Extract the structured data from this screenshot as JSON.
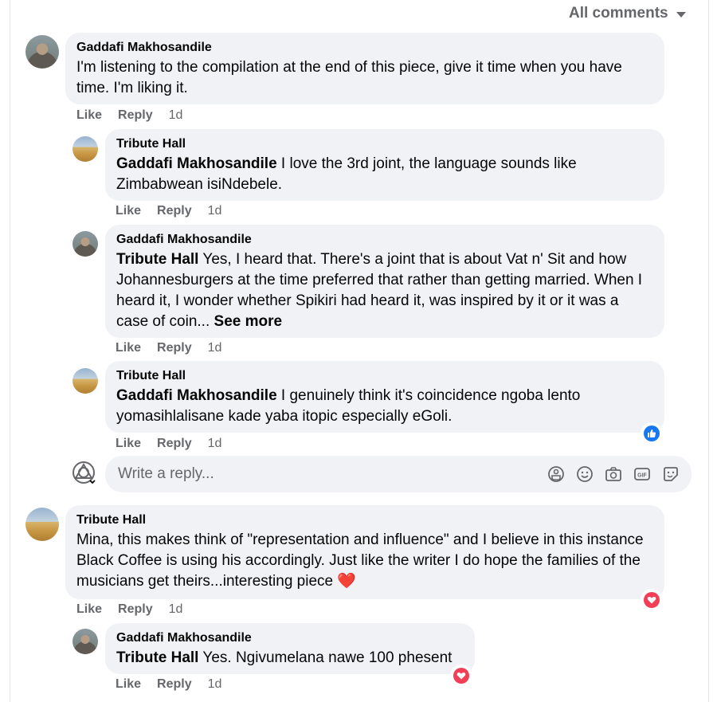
{
  "filter": {
    "label": "All comments",
    "icon": "caret-down-icon"
  },
  "comments": [
    {
      "author": "Gaddafi Makhosandile",
      "avatar": "person-photo",
      "text": "I'm listening to the compilation at the end of this piece, give it time when you have time. I'm liking it.",
      "actions": {
        "like": "Like",
        "reply": "Reply",
        "time": "1d"
      }
    },
    {
      "author": "Tribute Hall",
      "avatar": "field-photo",
      "mention": "Gaddafi Makhosandile",
      "text": " I love the 3rd joint, the language sounds like Zimbabwean isiNdebele.",
      "actions": {
        "like": "Like",
        "reply": "Reply",
        "time": "1d"
      }
    },
    {
      "author": "Gaddafi Makhosandile",
      "avatar": "person-photo",
      "mention": "Tribute Hall",
      "text": " Yes, I heard that. There's a joint that is about Vat n' Sit and how Johannesburgers at the time preferred that rather than getting married. When I heard it, I wonder whether Spikiri had heard it, was inspired by it or it was a case of coin... ",
      "see_more": "See more",
      "actions": {
        "like": "Like",
        "reply": "Reply",
        "time": "1d"
      }
    },
    {
      "author": "Tribute Hall",
      "avatar": "field-photo",
      "mention": "Gaddafi Makhosandile",
      "text": " I genuinely think it's coincidence ngoba lento yomasihlalisane kade yaba itopic especially eGoli.",
      "reaction": "like",
      "actions": {
        "like": "Like",
        "reply": "Reply",
        "time": "1d"
      }
    },
    {
      "author": "Tribute Hall",
      "avatar": "field-photo",
      "text": "Mina, this makes think of \"representation and influence\" and I believe in this instance Black Coffee is using his accordingly. Just like the writer I do hope the families of the musicians get theirs...interesting piece ",
      "emoji": "❤️",
      "reaction": "love",
      "actions": {
        "like": "Like",
        "reply": "Reply",
        "time": "1d"
      }
    },
    {
      "author": "Gaddafi Makhosandile",
      "avatar": "person-photo",
      "mention": "Tribute Hall",
      "text": " Yes. Ngivumelana nawe 100 phesent",
      "reaction": "love",
      "actions": {
        "like": "Like",
        "reply": "Reply",
        "time": "1d"
      }
    }
  ],
  "reply_box": {
    "placeholder": "Write a reply...",
    "avatar_icon": "account-switcher-icon",
    "tools": [
      "avatar-sticker-icon",
      "emoji-icon",
      "camera-icon",
      "gif-icon",
      "sticker-icon"
    ]
  },
  "colors": {
    "like_blue": "#1877f2",
    "love_red": "#f33e58",
    "bubble_bg": "#f0f2f5",
    "meta_gray": "#65676b"
  }
}
